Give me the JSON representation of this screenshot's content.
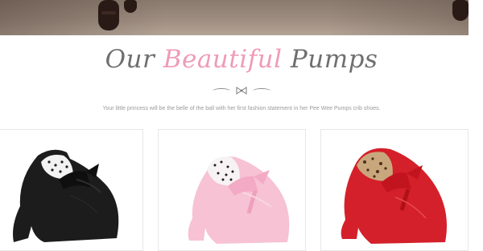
{
  "section": {
    "title_part1": "Our",
    "title_accent": "Beautiful",
    "title_part2": "Pumps",
    "tagline": "Your little princess will be the belle of the ball with her first fashion statement in her Pee Wee Pumps crib shoes."
  },
  "products": [
    {
      "color_name": "black",
      "color": "#1c1c1c",
      "ribbon": "#0f0f0f",
      "lining": "polka-dot"
    },
    {
      "color_name": "pink",
      "color": "#f6c2d4",
      "ribbon": "#f3aac4",
      "lining": "polka-dot"
    },
    {
      "color_name": "red",
      "color": "#d4202a",
      "ribbon": "#c2141f",
      "lining": "leopard"
    }
  ],
  "colors": {
    "accent": "#ef9bb8",
    "heading": "#6f6f6f",
    "text": "#9a9a9a"
  }
}
